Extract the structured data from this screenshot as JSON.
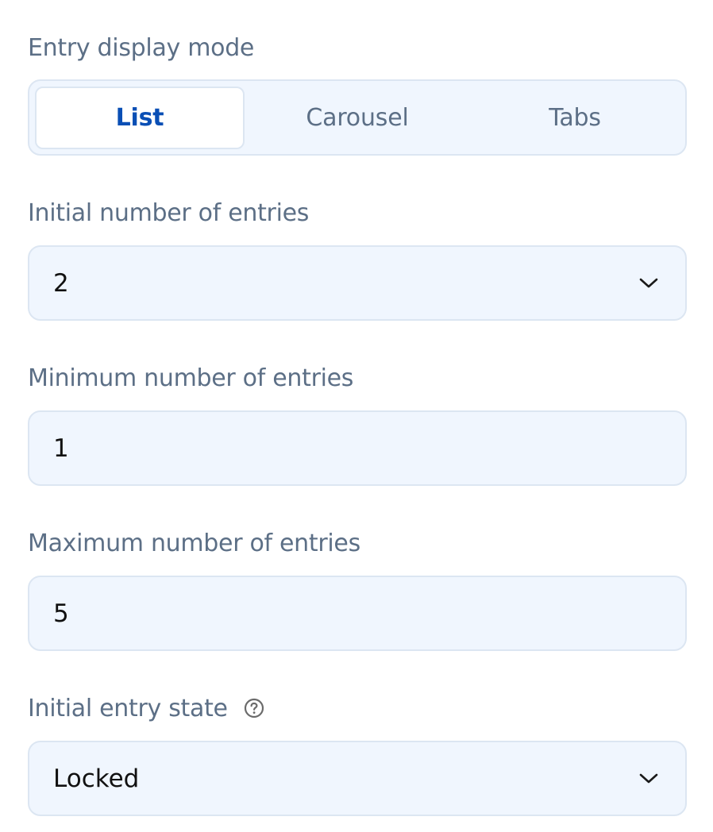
{
  "display_mode": {
    "label": "Entry display mode",
    "options": [
      "List",
      "Carousel",
      "Tabs"
    ],
    "selected": "List"
  },
  "initial_entries": {
    "label": "Initial number of entries",
    "value": "2",
    "icon": "chevron-down-icon"
  },
  "minimum_entries": {
    "label": "Minimum number of entries",
    "value": "1"
  },
  "maximum_entries": {
    "label": "Maximum number of entries",
    "value": "5"
  },
  "initial_state": {
    "label": "Initial entry state",
    "help_icon": "question-circle-icon",
    "value": "Locked",
    "icon": "chevron-down-icon"
  },
  "colors": {
    "field_background": "#f0f6fe",
    "border": "#dce6f2",
    "label_text": "#5c6f86",
    "active_accent": "#0a4fb5"
  }
}
